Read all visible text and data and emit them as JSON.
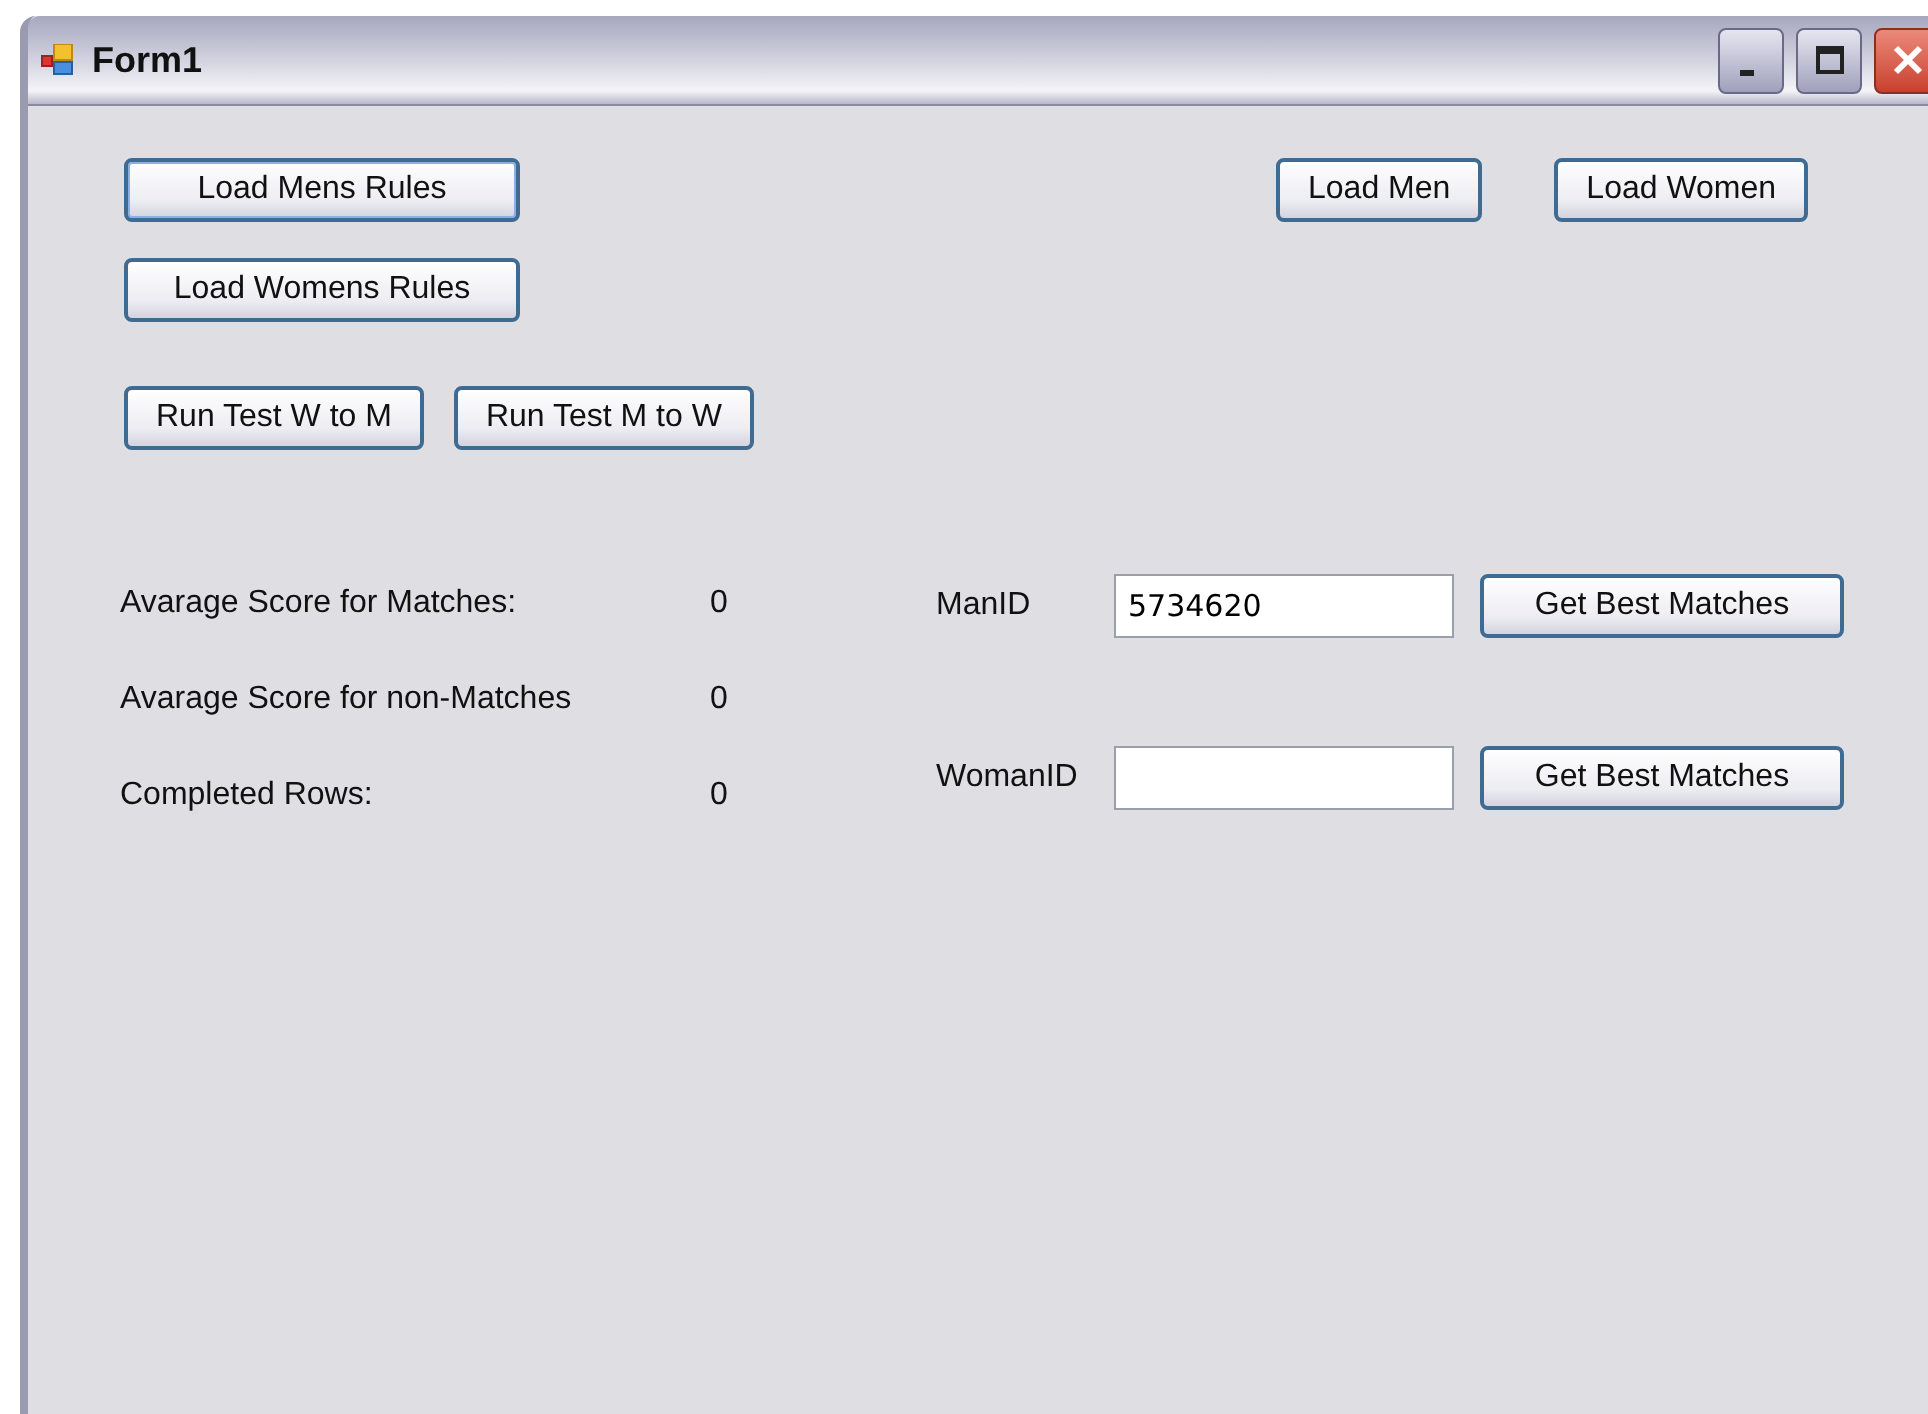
{
  "window": {
    "title": "Form1"
  },
  "rules_buttons": [
    "Load Mens Rules",
    "Load Womens Rules"
  ],
  "load_buttons": [
    "Load Men",
    "Load Women"
  ],
  "test_buttons": [
    "Run Test W to M",
    "Run Test M to W"
  ],
  "stats": [
    {
      "label": "Avarage Score for Matches:",
      "value": "0"
    },
    {
      "label": "Avarage Score for non-Matches",
      "value": "0"
    },
    {
      "label": "Completed Rows:",
      "value": "0"
    }
  ],
  "lookups": [
    {
      "label": "ManID",
      "value": "5734620",
      "button": "Get Best Matches"
    },
    {
      "label": "WomanID",
      "button": "Get Best Matches"
    }
  ]
}
